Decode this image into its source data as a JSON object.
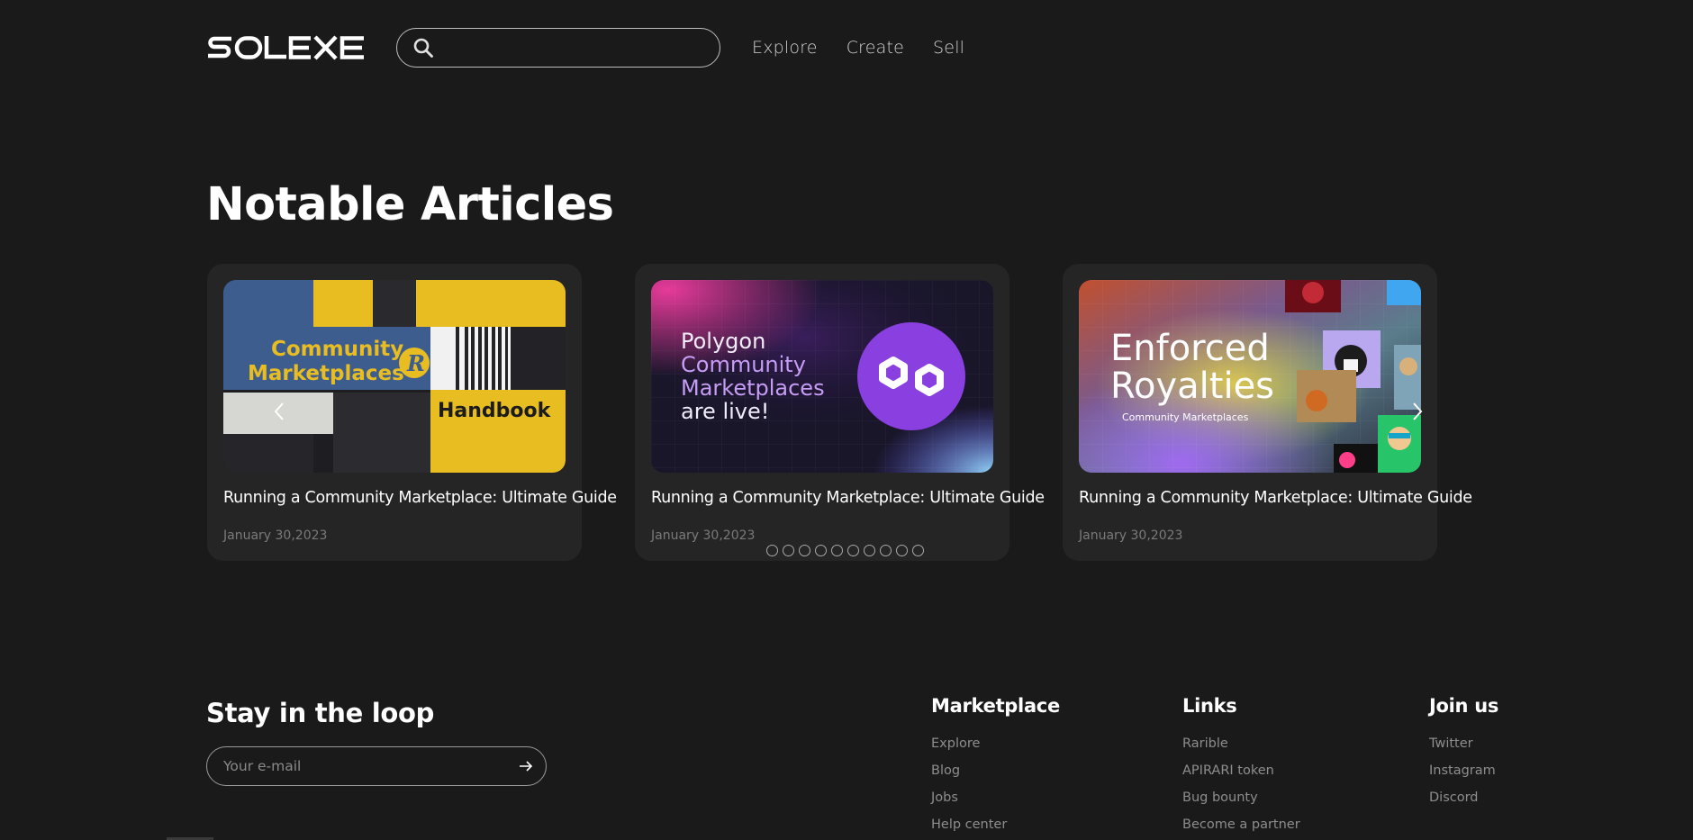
{
  "brand": {
    "logo_text": "SOLEXE"
  },
  "search": {
    "placeholder": ""
  },
  "nav": [
    {
      "label": "Explore"
    },
    {
      "label": "Create"
    },
    {
      "label": "Sell"
    }
  ],
  "articles": {
    "heading": "Notable Articles",
    "cards": [
      {
        "image_text": {
          "line1": "Community",
          "line2": "Marketplaces",
          "badge": "R",
          "handbook": "Handbook"
        },
        "title": "Running a Community Marketplace: Ultimate Guide",
        "date": "January 30,2023"
      },
      {
        "image_text": {
          "line1": "Polygon",
          "line2": "Community",
          "line3": "Marketplaces",
          "line4": "are live!"
        },
        "title": "Running a Community Marketplace: Ultimate Guide",
        "date": "January 30,2023"
      },
      {
        "image_text": {
          "line1": "Enforced",
          "line2": "Royalties",
          "sub": "Community Marketplaces"
        },
        "title": "Running a Community Marketplace: Ultimate Guide",
        "date": "January 30,2023"
      }
    ],
    "pagination": {
      "count": 10
    }
  },
  "newsletter": {
    "heading": "Stay in the loop",
    "placeholder": "Your e-mail"
  },
  "footer": {
    "marketplace": {
      "heading": "Marketplace",
      "links": [
        "Explore",
        "Blog",
        "Jobs",
        "Help center"
      ]
    },
    "links": {
      "heading": "Links",
      "links": [
        "Rarible",
        "APIRARI token",
        "Bug bounty",
        "Become a partner"
      ]
    },
    "join": {
      "heading": "Join us",
      "links": [
        "Twitter",
        "Instagram",
        "Discord"
      ]
    }
  },
  "colors": {
    "background": "#1a1a1a",
    "card": "#252525",
    "accent_yellow": "#e8bd22",
    "accent_blue": "#3e5d8f",
    "accent_purple": "#8a3fe0"
  }
}
